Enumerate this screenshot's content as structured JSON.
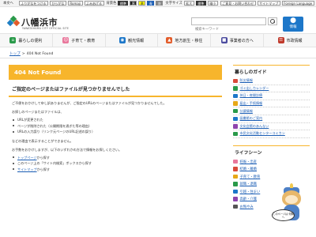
{
  "topbar": {
    "skip": "本文へ",
    "buttons": [
      "ふりがなをつける",
      "ひらがな",
      "Romaji",
      "よみあげる"
    ],
    "bg_label": "背景色",
    "bg_buttons": [
      "標準",
      "黒",
      "黄",
      "青",
      "灰"
    ],
    "size_label": "文字サイズ",
    "size_buttons": [
      "拡大",
      "標準",
      "縮小"
    ],
    "links": [
      "ご意見・お問い合わせ",
      "サイトマップ",
      "Foreign Language"
    ]
  },
  "header": {
    "site_name": "八幡浜市",
    "site_sub": "YAWATAHAMA CITY OFFICIAL SITE",
    "search_placeholder": "検索キーワード",
    "lang_label": "情報"
  },
  "nav": [
    {
      "label": "暮らしの便利",
      "icon": "house-icon",
      "color": "#2a9a4a"
    },
    {
      "label": "子育て・教育",
      "icon": "family-icon",
      "color": "#e9789c"
    },
    {
      "label": "観光情報",
      "icon": "camera-icon",
      "color": "#1d77c9"
    },
    {
      "label": "地方創生・移住",
      "icon": "map-icon",
      "color": "#e35c2a"
    },
    {
      "label": "事業者の方へ",
      "icon": "building-icon",
      "color": "#4b4b9f"
    },
    {
      "label": "市政情報",
      "icon": "document-icon",
      "color": "#c0392b"
    }
  ],
  "breadcrumb": {
    "home": "トップ",
    "current": "404 Not Found"
  },
  "main": {
    "title": "404 Not Found",
    "subtitle": "ご指定のページまたはファイルが見つかりませんでした",
    "p1": "ご不便をおかけして申し訳ありませんが、ご指定のURLのページまたはファイルが見つかりませんでした。",
    "p2": "お探しのページまたはファイルは、",
    "reasons": [
      "URLが変更された",
      "ページが削除された（公開期限を過ぎた等の理由）",
      "URLの入力誤り（リンク元ページのURL記述の誤り）"
    ],
    "p3": "などの理由で表示することができません。",
    "p4": "お手数をおかけしますが、以下のいずれかの方法で情報をお探しください。",
    "options": [
      {
        "link": "トップページ",
        "rest": "から探す"
      },
      {
        "link": "",
        "rest": "このページ上の「サイト内検索」ボックスから探す"
      },
      {
        "link": "サイトマップ",
        "rest": "から探す"
      }
    ]
  },
  "sidebar": {
    "guide_title": "暮らしのガイド",
    "guide_items": [
      {
        "label": "防災情報",
        "color": "#d94a3a"
      },
      {
        "label": "ゴミ出しカレンダー",
        "color": "#2a9a4a"
      },
      {
        "label": "休日・夜間診療",
        "color": "#1d77c9"
      },
      {
        "label": "届出・手続情報",
        "color": "#e6a817"
      },
      {
        "label": "分譲情報",
        "color": "#2a9a4a"
      },
      {
        "label": "図書館のご案内",
        "color": "#1d77c9"
      },
      {
        "label": "文化会館のあんない",
        "color": "#8e44ad"
      },
      {
        "label": "市民文化活動センターコミカン",
        "color": "#2a9a4a"
      }
    ],
    "life_title": "ライフシーン",
    "life_items": [
      {
        "label": "妊娠・出産",
        "color": "#e9789c"
      },
      {
        "label": "結婚・離婚",
        "color": "#d94a3a"
      },
      {
        "label": "子育て・教育",
        "color": "#e6a817"
      },
      {
        "label": "就職・退職",
        "color": "#2a9a4a"
      },
      {
        "label": "引越・住まい",
        "color": "#1d77c9"
      },
      {
        "label": "高齢・介護",
        "color": "#8e44ad"
      },
      {
        "label": "お悔やみ",
        "color": "#555555"
      }
    ],
    "mascot_text": "このページは 何階へ"
  }
}
